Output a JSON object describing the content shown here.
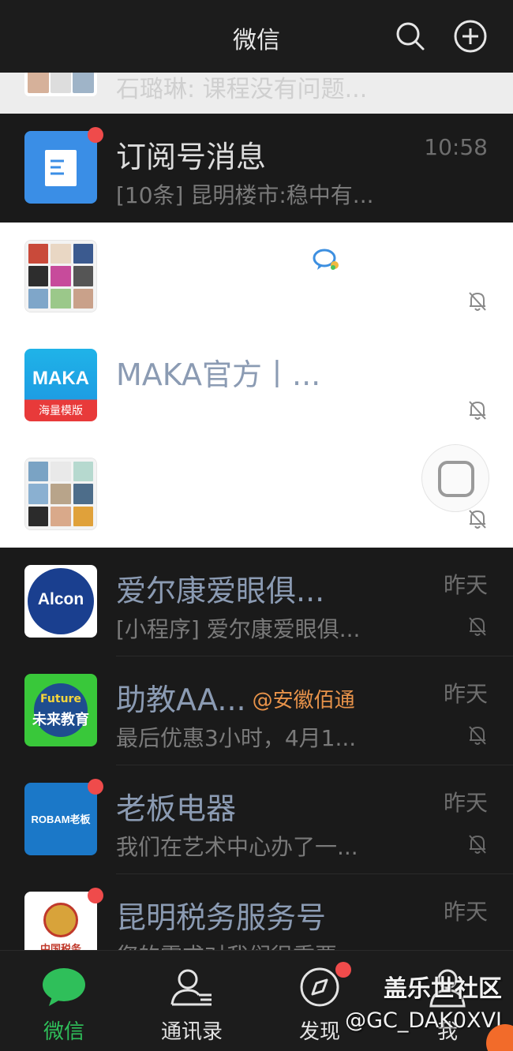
{
  "header": {
    "title": "微信"
  },
  "partial_row": {
    "text": "石璐琳: 课程没有问题..."
  },
  "rows": [
    {
      "name": "订阅号消息",
      "preview": "[10条] 昆明楼市:稳中有...",
      "time": "10:58"
    },
    {
      "name": "",
      "preview": "",
      "time": ""
    },
    {
      "name": "MAKA官方丨...",
      "preview": "",
      "time": "",
      "avatar_line1": "MAKA",
      "avatar_line2": "海量模版"
    },
    {
      "name": "",
      "preview": "",
      "time": ""
    },
    {
      "name": "爱尔康爱眼俱...",
      "preview": "[小程序] 爱尔康爱眼俱...",
      "time": "昨天",
      "avatar_text": "Alcon"
    },
    {
      "name": "助教AA...",
      "mention": "@安徽佰通",
      "preview": "最后优惠3小时，4月1...",
      "time": "昨天",
      "avatar_line1": "Future",
      "avatar_line2": "未来教育"
    },
    {
      "name": "老板电器",
      "preview": "我们在艺术中心办了一...",
      "time": "昨天",
      "avatar_text": "ROBAM老板"
    },
    {
      "name": "昆明税务服务号",
      "preview": "您的需求对我们很重要...",
      "time": "昨天",
      "avatar_text": "中国税务"
    }
  ],
  "tabs": [
    {
      "label": "微信"
    },
    {
      "label": "通讯录"
    },
    {
      "label": "发现"
    },
    {
      "label": "我"
    }
  ],
  "watermark": {
    "line1": "盖乐世社区",
    "line2": "@GC_DAK0XVJ"
  },
  "colors": {
    "active_tab": "#2fbf5a",
    "badge": "#ef4b4b",
    "mention": "#e8934a"
  }
}
